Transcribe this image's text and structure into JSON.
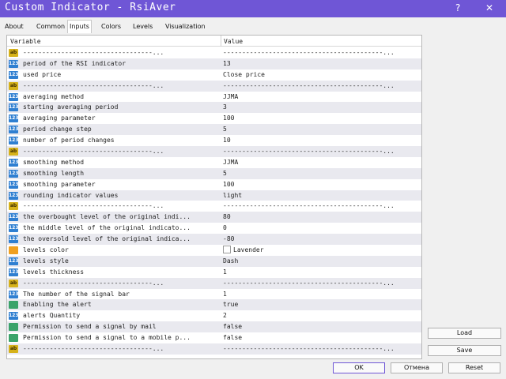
{
  "window": {
    "title": "Custom Indicator - RsiAver",
    "help_label": "?",
    "close_label": "✕"
  },
  "tabs": [
    {
      "label": "About"
    },
    {
      "label": "Common"
    },
    {
      "label": "Inputs"
    },
    {
      "label": "Colors"
    },
    {
      "label": "Levels"
    },
    {
      "label": "Visualization"
    }
  ],
  "active_tab": "Inputs",
  "table": {
    "columns": [
      "Variable",
      "Value"
    ],
    "rows": [
      {
        "icon": "ab",
        "variable": "----------------------------------...",
        "value": "------------------------------------------..."
      },
      {
        "icon": "123",
        "variable": "period of the RSI indicator",
        "value": "13"
      },
      {
        "icon": "123",
        "variable": "used price",
        "value": "Close price"
      },
      {
        "icon": "ab",
        "variable": "----------------------------------...",
        "value": "------------------------------------------..."
      },
      {
        "icon": "123",
        "variable": "averaging method",
        "value": "JJMA"
      },
      {
        "icon": "123",
        "variable": "starting averaging period",
        "value": "3"
      },
      {
        "icon": "123",
        "variable": "averaging parameter",
        "value": "100"
      },
      {
        "icon": "123",
        "variable": "period change step",
        "value": "5"
      },
      {
        "icon": "123",
        "variable": "number of period changes",
        "value": "10"
      },
      {
        "icon": "ab",
        "variable": "----------------------------------...",
        "value": "------------------------------------------..."
      },
      {
        "icon": "123",
        "variable": "smoothing method",
        "value": "JJMA"
      },
      {
        "icon": "123",
        "variable": "smoothing length",
        "value": "5"
      },
      {
        "icon": "123",
        "variable": "smoothing parameter",
        "value": "100"
      },
      {
        "icon": "123",
        "variable": "rounding indicator values",
        "value": "light"
      },
      {
        "icon": "ab",
        "variable": "----------------------------------...",
        "value": "------------------------------------------..."
      },
      {
        "icon": "123",
        "variable": "the overbought level of the original indi...",
        "value": "80"
      },
      {
        "icon": "123",
        "variable": "the middle level of the original indicato...",
        "value": "0"
      },
      {
        "icon": "123",
        "variable": "the oversold level of the original indica...",
        "value": "-80"
      },
      {
        "icon": "color",
        "variable": "levels color",
        "value": "Lavender"
      },
      {
        "icon": "123",
        "variable": "levels style",
        "value": "Dash"
      },
      {
        "icon": "123",
        "variable": "levels thickness",
        "value": "1"
      },
      {
        "icon": "ab",
        "variable": "----------------------------------...",
        "value": "------------------------------------------..."
      },
      {
        "icon": "123",
        "variable": "The number of the signal bar",
        "value": "1"
      },
      {
        "icon": "alert",
        "variable": "Enabling the alert",
        "value": "true"
      },
      {
        "icon": "123",
        "variable": "alerts Quantity",
        "value": "2"
      },
      {
        "icon": "alert",
        "variable": "Permission to send a signal by mail",
        "value": "false"
      },
      {
        "icon": "alert",
        "variable": "Permission to send a signal to a mobile p...",
        "value": "false"
      },
      {
        "icon": "ab",
        "variable": "----------------------------------...",
        "value": "------------------------------------------..."
      }
    ]
  },
  "icon_labels": {
    "ab": "ab",
    "123": "123",
    "color": "",
    "alert": ""
  },
  "buttons": {
    "load": "Load",
    "save": "Save",
    "ok": "OK",
    "cancel": "Отмена",
    "reset": "Reset"
  },
  "colors": {
    "titlebar": "#6f56d6",
    "row_alt": "#e9e9ef"
  }
}
